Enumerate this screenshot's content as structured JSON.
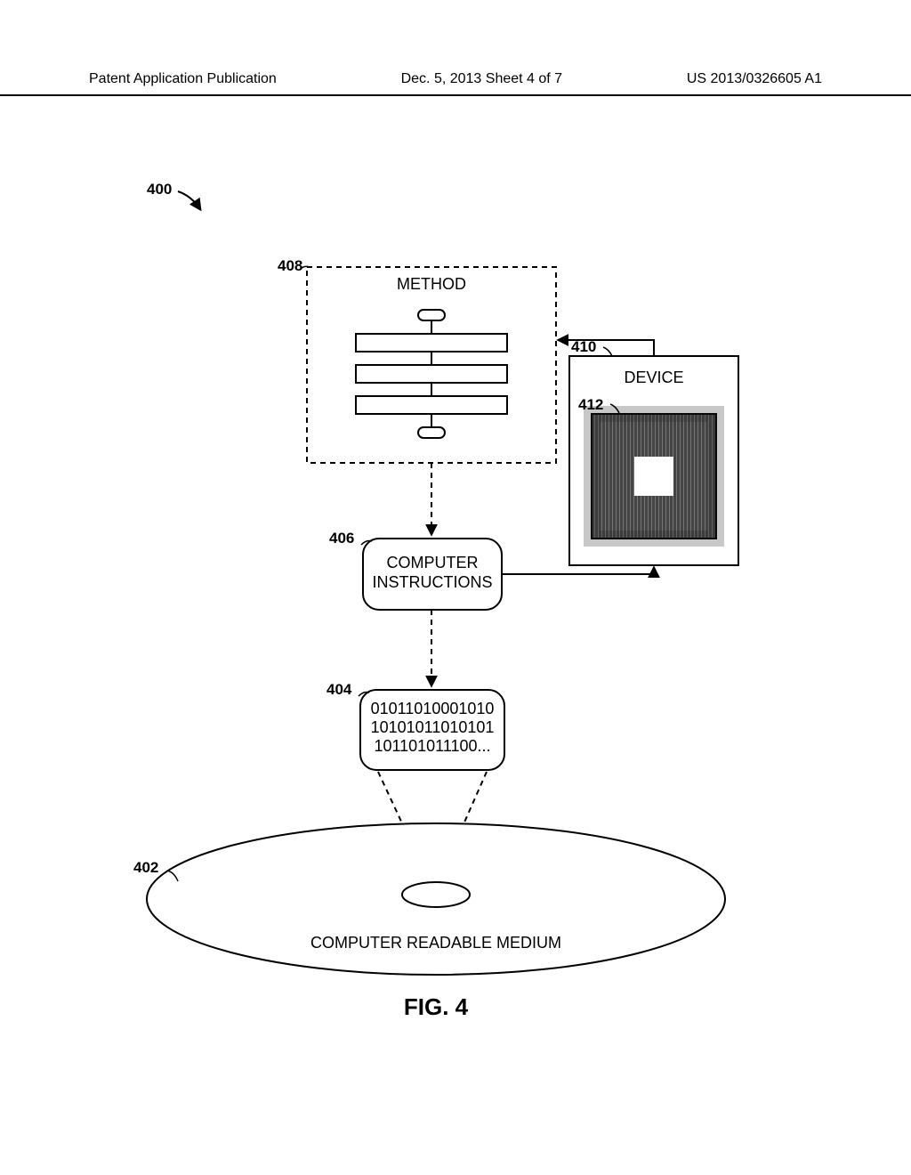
{
  "header": {
    "left": "Patent Application Publication",
    "center": "Dec. 5, 2013  Sheet 4 of 7",
    "right": "US 2013/0326605 A1"
  },
  "refs": {
    "r400": "400",
    "r402": "402",
    "r404": "404",
    "r406": "406",
    "r408": "408",
    "r410": "410",
    "r412": "412"
  },
  "labels": {
    "method": "METHOD",
    "device": "DEVICE",
    "instructions_l1": "COMPUTER",
    "instructions_l2": "INSTRUCTIONS",
    "bin1": "01011010001010",
    "bin2": "10101011010101",
    "bin3": "101101011100...",
    "medium": "COMPUTER READABLE MEDIUM",
    "figure": "FIG. 4"
  }
}
